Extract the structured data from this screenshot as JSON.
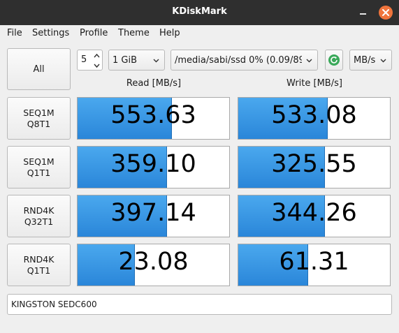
{
  "window": {
    "title": "KDiskMark"
  },
  "menu": [
    "File",
    "Settings",
    "Profile",
    "Theme",
    "Help"
  ],
  "controls": {
    "all_label": "All",
    "loops": "5",
    "size": "1 GiB",
    "directory": "/media/sabi/ssd 0% (0.09/89",
    "unit": "MB/s"
  },
  "columns": {
    "read": "Read [MB/s]",
    "write": "Write [MB/s]"
  },
  "tests": [
    {
      "label": "SEQ1M\nQ8T1",
      "read": "553.63",
      "write": "533.08",
      "read_level": 0.62,
      "write_level": 0.59
    },
    {
      "label": "SEQ1M\nQ1T1",
      "read": "359.10",
      "write": "325.55",
      "read_level": 0.59,
      "write_level": 0.57
    },
    {
      "label": "RND4K\nQ32T1",
      "read": "397.14",
      "write": "344.26",
      "read_level": 0.59,
      "write_level": 0.57
    },
    {
      "label": "RND4K\nQ1T1",
      "read": "23.08",
      "write": "61.31",
      "read_level": 0.38,
      "write_level": 0.46
    }
  ],
  "device": "KINGSTON SEDC600",
  "colors": {
    "bar": "#2a86d9",
    "close_button": "#f0743c",
    "refresh_icon": "#3aa95a"
  },
  "icons": [
    "minimize-icon",
    "close-icon",
    "chevron-up-icon",
    "chevron-down-icon",
    "refresh-icon"
  ]
}
